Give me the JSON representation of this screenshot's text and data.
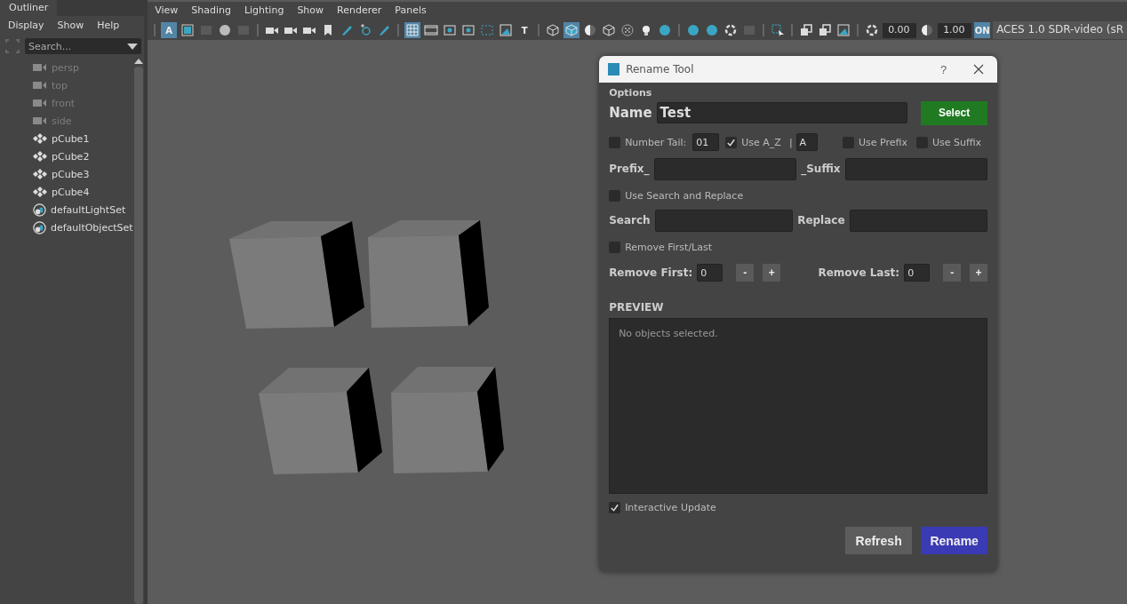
{
  "outliner": {
    "tab": "Outliner",
    "menu": [
      "Display",
      "Show",
      "Help"
    ],
    "search": {
      "placeholder": "Search..."
    },
    "items": [
      {
        "label": "persp",
        "kind": "camera",
        "dimmed": true
      },
      {
        "label": "top",
        "kind": "camera",
        "dimmed": true
      },
      {
        "label": "front",
        "kind": "camera",
        "dimmed": true
      },
      {
        "label": "side",
        "kind": "camera",
        "dimmed": true
      },
      {
        "label": "pCube1",
        "kind": "transform",
        "dimmed": false
      },
      {
        "label": "pCube2",
        "kind": "transform",
        "dimmed": false
      },
      {
        "label": "pCube3",
        "kind": "transform",
        "dimmed": false
      },
      {
        "label": "pCube4",
        "kind": "transform",
        "dimmed": false
      },
      {
        "label": "defaultLightSet",
        "kind": "set",
        "dimmed": false
      },
      {
        "label": "defaultObjectSet",
        "kind": "set",
        "dimmed": false
      }
    ]
  },
  "viewport": {
    "menu": [
      "View",
      "Shading",
      "Lighting",
      "Show",
      "Renderer",
      "Panels"
    ],
    "toolbar": [
      {
        "kind": "sep"
      },
      {
        "kind": "glyph",
        "text": "A",
        "on": true
      },
      {
        "kind": "frame",
        "on": false
      },
      {
        "kind": "box",
        "on": false
      },
      {
        "kind": "sphere",
        "on": false
      },
      {
        "kind": "box",
        "on": false
      },
      {
        "kind": "sep"
      },
      {
        "kind": "camera",
        "on": false
      },
      {
        "kind": "camera",
        "on": false
      },
      {
        "kind": "camera",
        "on": false
      },
      {
        "kind": "bookmark",
        "on": false
      },
      {
        "kind": "pen",
        "on": false
      },
      {
        "kind": "magnify",
        "on": false
      },
      {
        "kind": "pen",
        "on": false
      },
      {
        "kind": "sep"
      },
      {
        "kind": "grid",
        "on": true
      },
      {
        "kind": "film",
        "on": false
      },
      {
        "kind": "dot",
        "on": false
      },
      {
        "kind": "dot",
        "on": false
      },
      {
        "kind": "dashed",
        "on": false
      },
      {
        "kind": "image",
        "on": false
      },
      {
        "kind": "glyph",
        "text": "T",
        "on": false
      },
      {
        "kind": "sep"
      },
      {
        "kind": "cube",
        "on": false
      },
      {
        "kind": "cube",
        "on": true
      },
      {
        "kind": "half",
        "on": false
      },
      {
        "kind": "cube",
        "on": false
      },
      {
        "kind": "checker",
        "on": false
      },
      {
        "kind": "bulb",
        "on": false
      },
      {
        "kind": "sphere",
        "on": false
      },
      {
        "kind": "sep"
      },
      {
        "kind": "sphere",
        "on": false
      },
      {
        "kind": "sphere",
        "on": false
      },
      {
        "kind": "ring",
        "on": false
      },
      {
        "kind": "box",
        "on": false
      },
      {
        "kind": "sep"
      },
      {
        "kind": "select",
        "on": false
      },
      {
        "kind": "sep"
      },
      {
        "kind": "copy",
        "on": false
      },
      {
        "kind": "copy",
        "on": false
      },
      {
        "kind": "image",
        "on": false
      },
      {
        "kind": "sep"
      },
      {
        "kind": "ring",
        "on": false
      },
      {
        "kind": "field",
        "text": "0.00"
      },
      {
        "kind": "half",
        "on": false
      },
      {
        "kind": "field",
        "text": "1.00"
      },
      {
        "kind": "glyph",
        "text": "ON",
        "on": true
      },
      {
        "kind": "dropdown",
        "text": "ACES 1.0 SDR-video (sR"
      }
    ]
  },
  "rename_tool": {
    "title": "Rename Tool",
    "help": "?",
    "section": "Options",
    "name_label": "Name",
    "name_value": "Test",
    "select_button": "Select",
    "number_tail": {
      "label": "Number Tail:",
      "checked": false,
      "value": "01"
    },
    "use_az": {
      "label": "Use A_Z",
      "checked": true,
      "separator": "|",
      "value": "A"
    },
    "use_prefix": {
      "label": "Use Prefix",
      "checked": false
    },
    "use_suffix": {
      "label": "Use Suffix",
      "checked": false
    },
    "prefix_label": "Prefix_",
    "suffix_label": "_Suffix",
    "search_replace": {
      "label": "Use Search and Replace",
      "checked": false
    },
    "search_label": "Search",
    "replace_label": "Replace",
    "remove_first_last": {
      "label": "Remove First/Last",
      "checked": false
    },
    "remove_first": {
      "label": "Remove First:",
      "value": "0",
      "minus": "-",
      "plus": "+"
    },
    "remove_last": {
      "label": "Remove Last:",
      "value": "0",
      "minus": "-",
      "plus": "+"
    },
    "preview_title": "PREVIEW",
    "preview_text": "No objects selected.",
    "interactive_update": {
      "label": "Interactive Update",
      "checked": true
    },
    "buttons": [
      "Refresh",
      "Rename"
    ]
  }
}
